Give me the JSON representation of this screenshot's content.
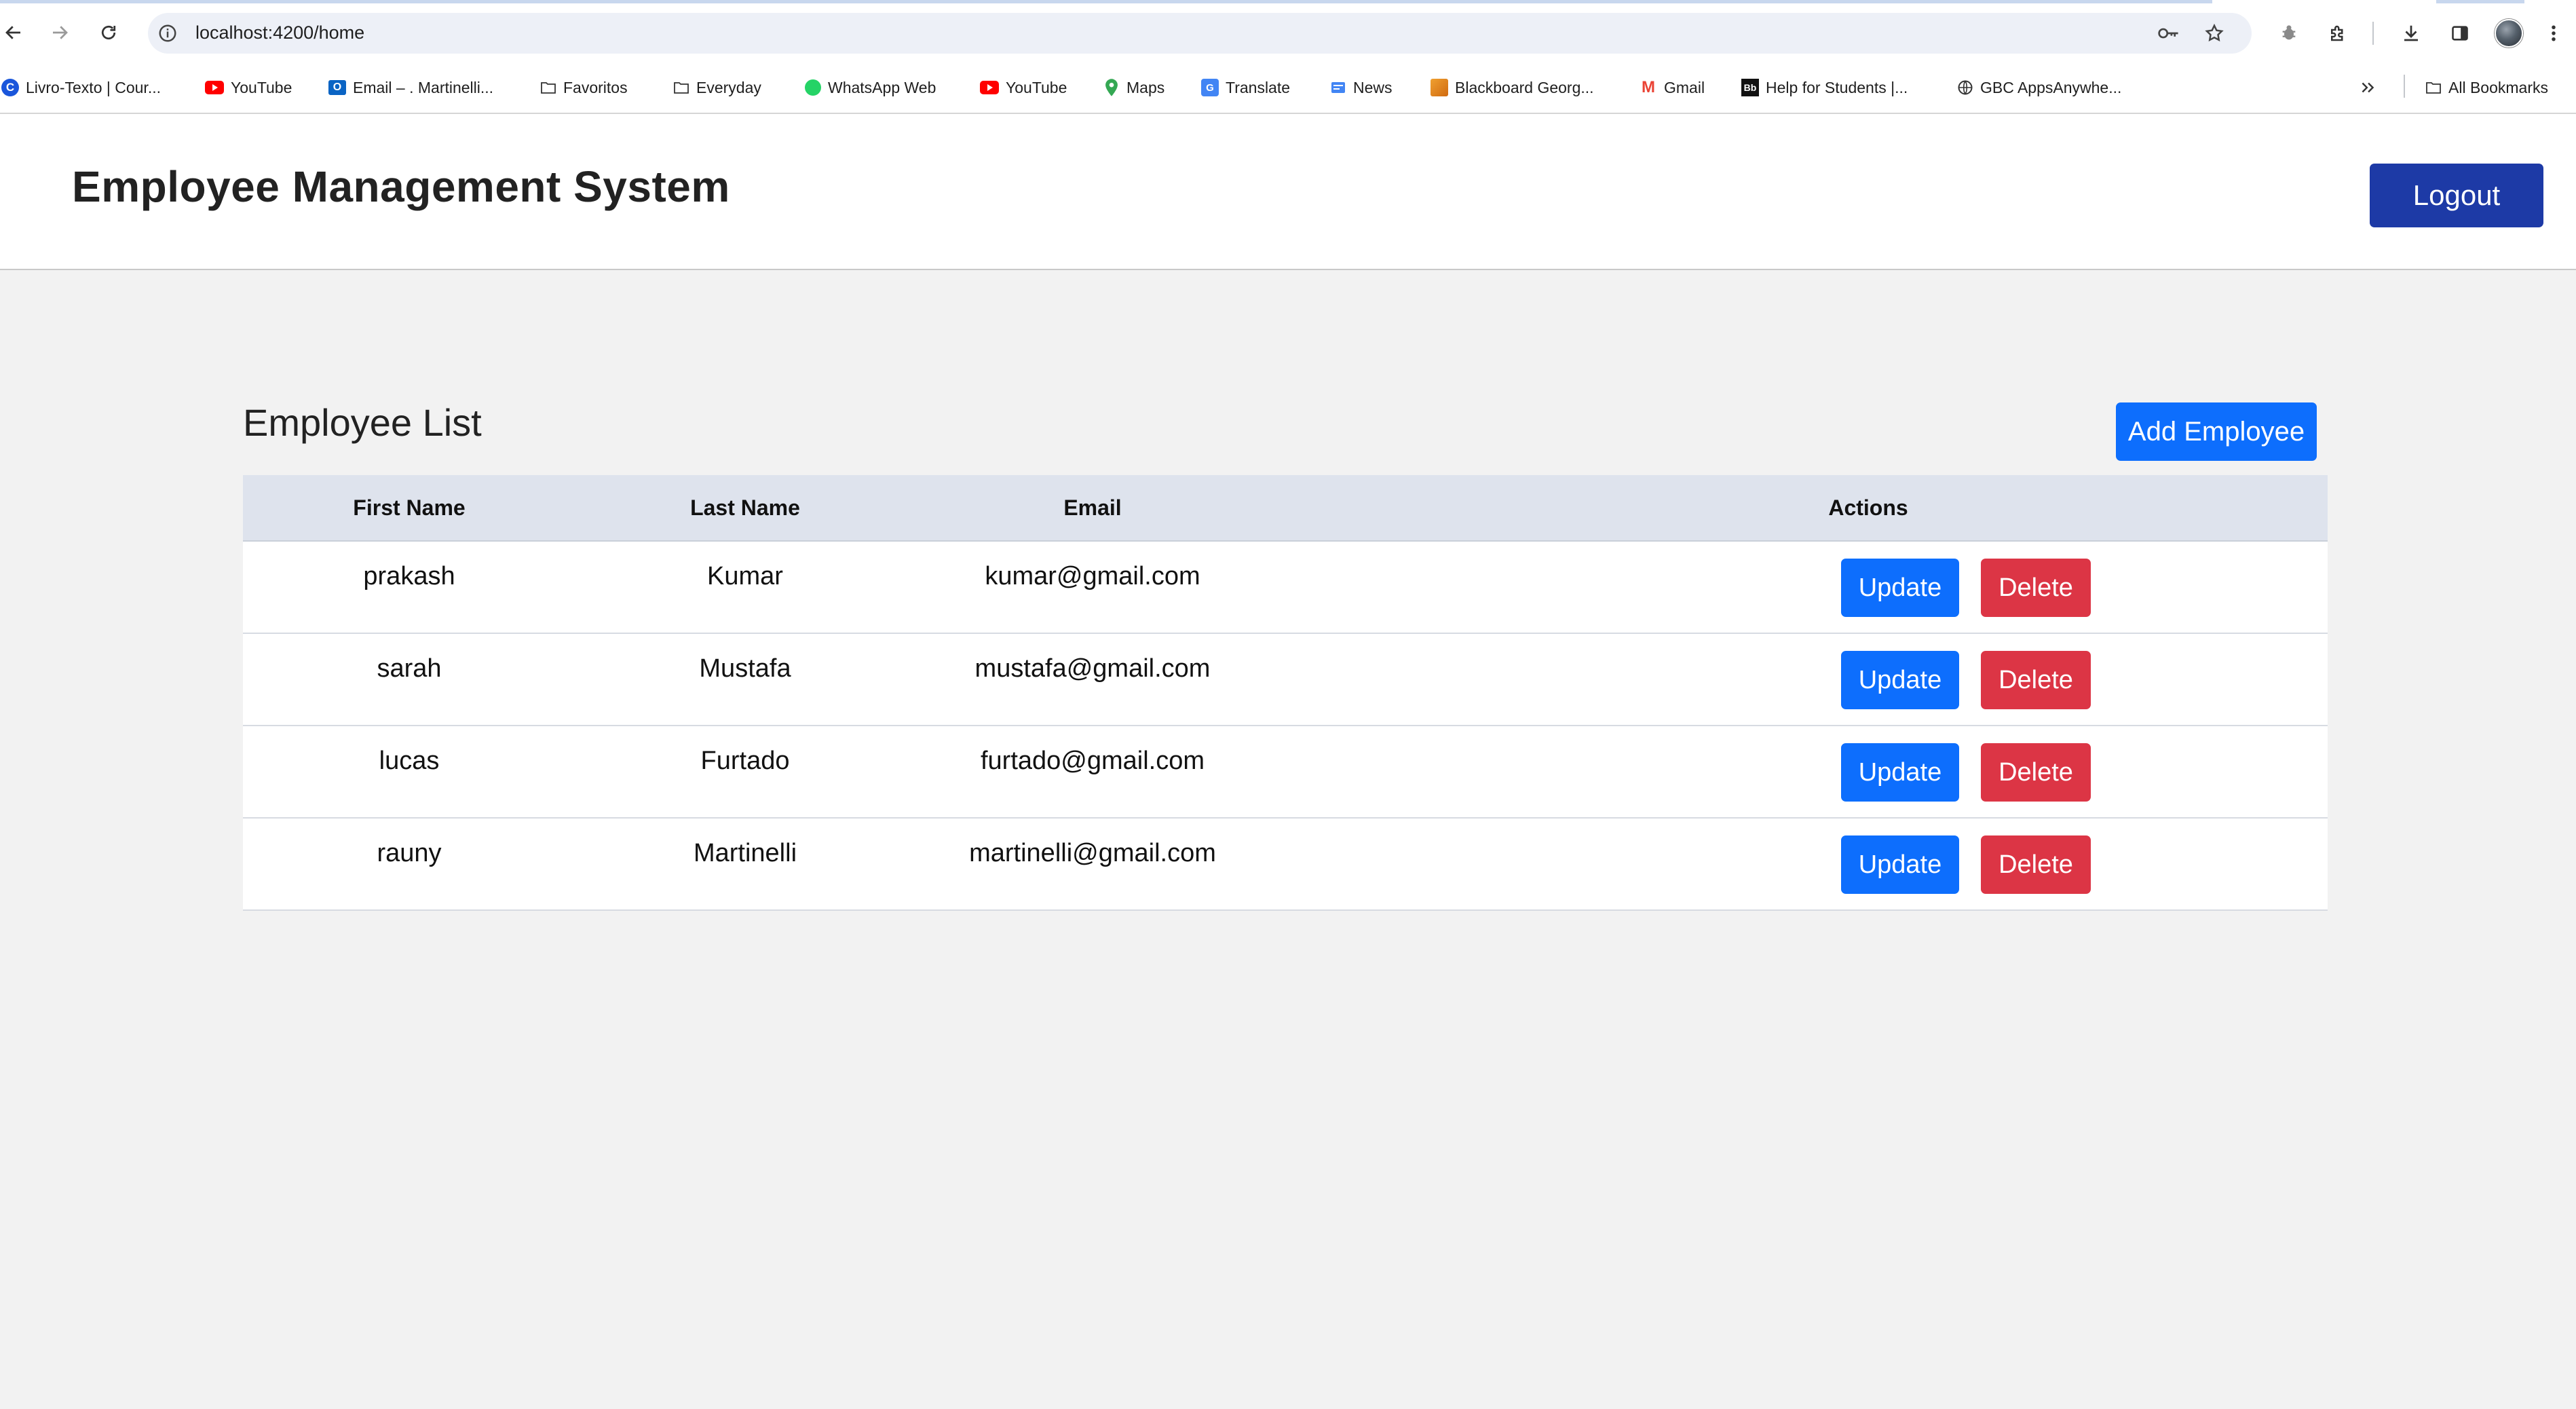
{
  "browser": {
    "url": "localhost:4200/home",
    "bookmarks": [
      {
        "label": "Livro-Texto | Cour...",
        "icon": "letter-c-icon"
      },
      {
        "label": "YouTube",
        "icon": "youtube-icon"
      },
      {
        "label": "Email – . Martinelli...",
        "icon": "outlook-icon"
      },
      {
        "label": "Favoritos",
        "icon": "folder-icon"
      },
      {
        "label": "Everyday",
        "icon": "folder-icon"
      },
      {
        "label": "WhatsApp Web",
        "icon": "whatsapp-icon"
      },
      {
        "label": "YouTube",
        "icon": "youtube-icon"
      },
      {
        "label": "Maps",
        "icon": "maps-pin-icon"
      },
      {
        "label": "Translate",
        "icon": "translate-icon"
      },
      {
        "label": "News",
        "icon": "news-icon"
      },
      {
        "label": "Blackboard Georg...",
        "icon": "blackboard-icon"
      },
      {
        "label": "Gmail",
        "icon": "gmail-icon"
      },
      {
        "label": "Help for Students |...",
        "icon": "bb-icon"
      },
      {
        "label": "GBC AppsAnywhe...",
        "icon": "globe-icon"
      }
    ],
    "all_bookmarks": "All Bookmarks"
  },
  "app": {
    "title": "Employee Management System",
    "logout_label": "Logout"
  },
  "employees": {
    "title": "Employee List",
    "add_label": "Add Employee",
    "columns": [
      "First Name",
      "Last Name",
      "Email",
      "Actions"
    ],
    "update_label": "Update",
    "delete_label": "Delete",
    "rows": [
      {
        "first": "prakash",
        "last": "Kumar",
        "email": "kumar@gmail.com"
      },
      {
        "first": "sarah",
        "last": "Mustafa",
        "email": "mustafa@gmail.com"
      },
      {
        "first": "lucas",
        "last": "Furtado",
        "email": "furtado@gmail.com"
      },
      {
        "first": "rauny",
        "last": "Martinelli",
        "email": "martinelli@gmail.com"
      }
    ]
  },
  "colors": {
    "primary": "#0d6efd",
    "danger": "#dc3545",
    "logout": "#1d3aa6",
    "table_header": "#dee3ed",
    "page_bg": "#f2f2f2"
  }
}
